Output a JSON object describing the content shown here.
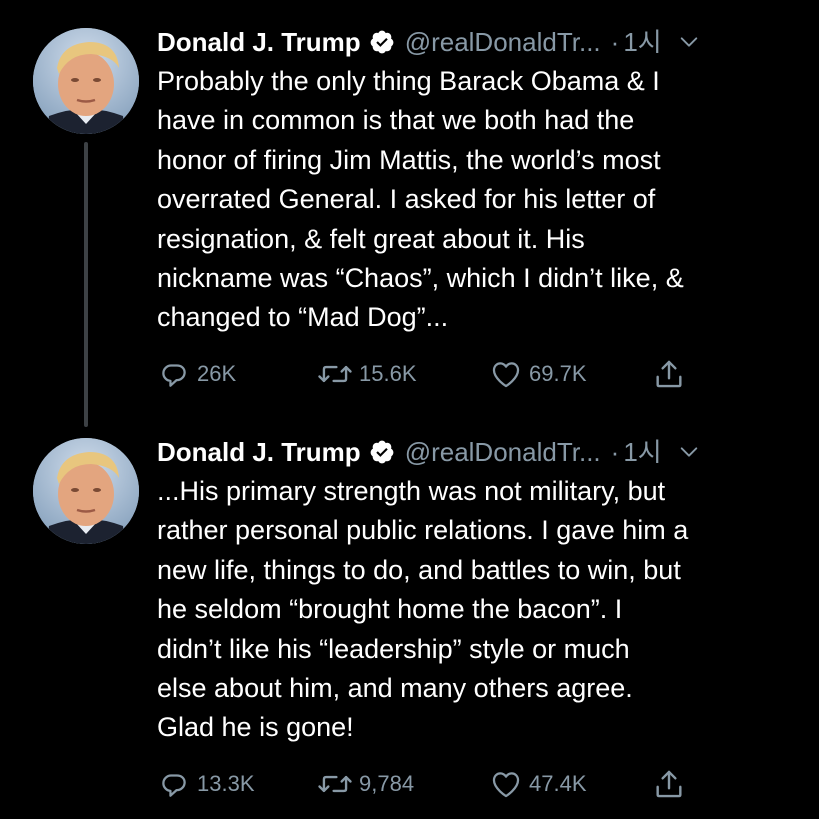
{
  "colors": {
    "background": "#000000",
    "primary_text": "#ffffff",
    "secondary_text": "#8899a6",
    "verified_badge": "#ffffff",
    "thread_line": "#3d4145"
  },
  "tweets": [
    {
      "author_name": "Donald J. Trump",
      "verified": true,
      "handle": "@realDonaldTr...",
      "separator": "·",
      "time": "1시",
      "text_lines": [
        "Probably the only thing Barack Obama & I",
        "have in common is that we both had the",
        "honor of firing Jim Mattis, the world’s most",
        "overrated General. I asked for his letter of",
        "resignation, & felt great about it. His",
        "nickname was “Chaos”, which I didn’t like, &",
        "changed to “Mad Dog”..."
      ],
      "replies": "26K",
      "retweets": "15.6K",
      "likes": "69.7K",
      "icons": [
        "reply-icon",
        "retweet-icon",
        "like-icon",
        "share-icon"
      ]
    },
    {
      "author_name": "Donald J. Trump",
      "verified": true,
      "handle": "@realDonaldTr...",
      "separator": "·",
      "time": "1시",
      "text_lines": [
        "...His primary strength was not military, but",
        "rather personal public relations. I gave him a",
        "new life, things to do, and battles to win, but",
        "he seldom “brought home the bacon”. I",
        "didn’t like his “leadership” style or much",
        "else about him, and many others agree.",
        "Glad he is gone!"
      ],
      "replies": "13.3K",
      "retweets": "9,784",
      "likes": "47.4K",
      "icons": [
        "reply-icon",
        "retweet-icon",
        "like-icon",
        "share-icon"
      ]
    }
  ]
}
